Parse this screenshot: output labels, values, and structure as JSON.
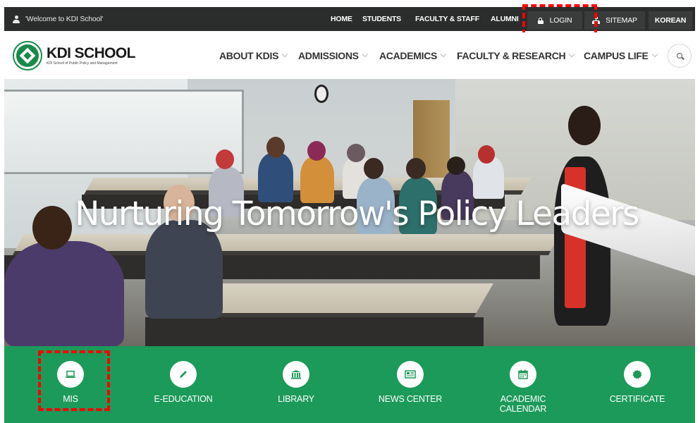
{
  "topbar": {
    "welcome": "'Welcome to KDI School'",
    "links": {
      "home": "HOME",
      "students": "STUDENTS",
      "faculty_staff": "FACULTY & STAFF",
      "alumni": "ALUMNI"
    },
    "login": "LOGIN",
    "sitemap": "SITEMAP",
    "korean": "KOREAN"
  },
  "logo": {
    "title": "KDI SCHOOL",
    "subtitle": "KDI School of Public Policy and Management"
  },
  "nav": {
    "items": [
      {
        "label": "ABOUT KDIS"
      },
      {
        "label": "ADMISSIONS"
      },
      {
        "label": "ACADEMICS"
      },
      {
        "label": "FACULTY & RESEARCH"
      },
      {
        "label": "CAMPUS LIFE"
      }
    ],
    "search_icon": "search-icon"
  },
  "hero": {
    "title": "Nurturing Tomorrow's Policy Leaders"
  },
  "quick_links": [
    {
      "label": "MIS",
      "icon": "laptop-icon"
    },
    {
      "label": "E-EDUCATION",
      "icon": "pencil-icon"
    },
    {
      "label": "LIBRARY",
      "icon": "bank-icon"
    },
    {
      "label": "NEWS CENTER",
      "icon": "newspaper-icon"
    },
    {
      "label": "ACADEMIC",
      "label2": "CALENDAR",
      "icon": "calendar-icon"
    },
    {
      "label": "CERTIFICATE",
      "icon": "certificate-icon"
    }
  ],
  "colors": {
    "topbar": "#2b2c2c",
    "brand_green": "#1c9a5a",
    "highlight": "#ff0000"
  }
}
